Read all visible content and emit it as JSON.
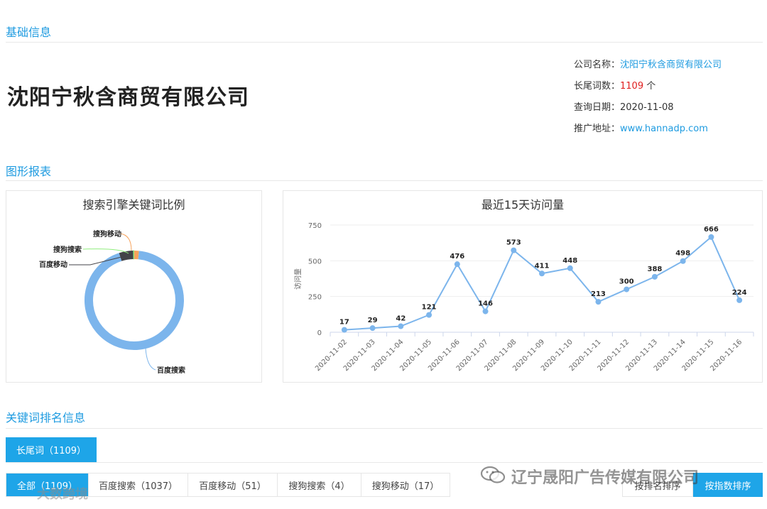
{
  "sections": {
    "basic_info": "基础信息",
    "charts": "图形报表",
    "keyword_rank": "关键词排名信息"
  },
  "company": {
    "name": "沈阳宁秋含商贸有限公司"
  },
  "info": {
    "company_label": "公司名称：",
    "company_value": "沈阳宁秋含商贸有限公司",
    "longtail_label": "长尾词数：",
    "longtail_value": "1109",
    "longtail_unit": " 个",
    "date_label": "查询日期：",
    "date_value": "2020-11-08",
    "url_label": "推广地址：",
    "url_value": "www.hannadp.com"
  },
  "chart_data": [
    {
      "type": "pie",
      "title": "搜索引擎关键词比例",
      "categories": [
        "百度搜索",
        "百度移动",
        "搜狗搜索",
        "搜狗移动"
      ],
      "values": [
        1037,
        51,
        4,
        17
      ],
      "colors": [
        "#7cb5ec",
        "#434348",
        "#90ed7d",
        "#f7a35c"
      ]
    },
    {
      "type": "line",
      "title": "最近15天访问量",
      "ylabel": "访问量",
      "x": [
        "2020-11-02",
        "2020-11-03",
        "2020-11-04",
        "2020-11-05",
        "2020-11-06",
        "2020-11-07",
        "2020-11-08",
        "2020-11-09",
        "2020-11-10",
        "2020-11-11",
        "2020-11-12",
        "2020-11-13",
        "2020-11-14",
        "2020-11-15",
        "2020-11-16"
      ],
      "values": [
        17,
        29,
        42,
        121,
        476,
        146,
        573,
        411,
        448,
        213,
        300,
        388,
        498,
        666,
        224
      ],
      "yticks": [
        "0",
        "250",
        "500",
        "750"
      ],
      "ylim": [
        0,
        750
      ],
      "color": "#7cb5ec"
    }
  ],
  "tabs": {
    "longtail": "长尾词（1109）",
    "sub": [
      "全部（1109）",
      "百度搜索（1037）",
      "百度移动（51）",
      "搜狗搜索（4）",
      "搜狗移动（17）"
    ],
    "sort_rank": "按排名排序",
    "sort_index": "按指数排序"
  },
  "watermarks": {
    "main": "辽宁晟阳广告传媒有限公司",
    "small": "大数跨境"
  }
}
